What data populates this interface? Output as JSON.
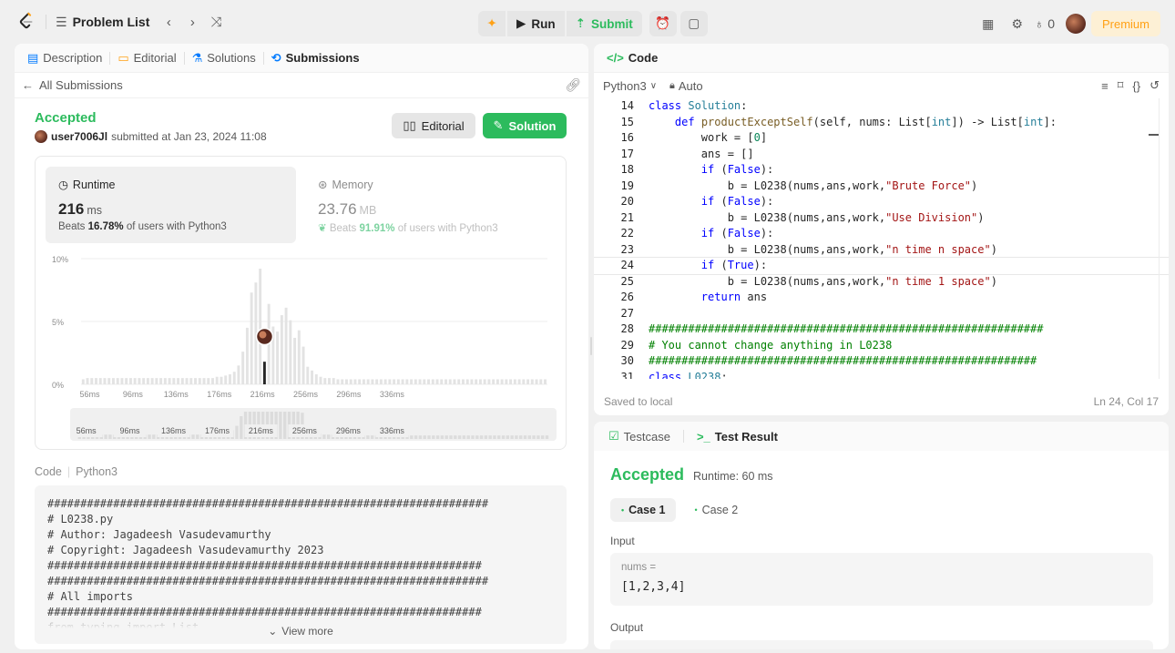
{
  "topbar": {
    "problem_list_label": "Problem List",
    "run_label": "Run",
    "submit_label": "Submit",
    "fire_count": "0",
    "premium_label": "Premium"
  },
  "left_tabs": {
    "description": "Description",
    "editorial": "Editorial",
    "solutions": "Solutions",
    "submissions": "Submissions"
  },
  "submission": {
    "back_label": "All Submissions",
    "status": "Accepted",
    "user": "user7006Jl",
    "submitted_text": "submitted at Jan 23, 2024 11:08",
    "editorial_button": "Editorial",
    "solution_button": "Solution",
    "runtime": {
      "label": "Runtime",
      "value": "216",
      "unit": "ms",
      "beats_prefix": "Beats",
      "beats_pct": "16.78%",
      "beats_suffix": "of users with Python3"
    },
    "memory": {
      "label": "Memory",
      "value": "23.76",
      "unit": "MB",
      "beats_prefix": "Beats",
      "beats_pct": "91.91%",
      "beats_suffix": "of users with Python3"
    },
    "code_label": "Code",
    "code_lang": "Python3",
    "code_lines": [
      "###################################################################",
      "# L0238.py",
      "# Author: Jagadeesh Vasudevamurthy",
      "# Copyright: Jagadeesh Vasudevamurthy 2023",
      "##################################################################",
      "###################################################################",
      "# All imports",
      "##################################################################",
      "from typing import List"
    ],
    "view_more": "View more"
  },
  "chart_data": {
    "type": "bar",
    "title": "",
    "xlabel": "",
    "ylabel": "",
    "ylim": [
      0,
      10
    ],
    "y_ticks": [
      "10%",
      "5%",
      "0%"
    ],
    "x_tick_labels": [
      "56ms",
      "96ms",
      "136ms",
      "176ms",
      "216ms",
      "256ms",
      "296ms",
      "336ms"
    ],
    "x_tick_values": [
      56,
      96,
      136,
      176,
      216,
      256,
      296,
      336
    ],
    "bin_width_ms": 4,
    "x_start_ms": 48,
    "values": [
      0.4,
      0.5,
      0.5,
      0.5,
      0.5,
      0.5,
      0.5,
      0.5,
      0.5,
      0.5,
      0.5,
      0.5,
      0.5,
      0.5,
      0.5,
      0.5,
      0.5,
      0.5,
      0.5,
      0.5,
      0.5,
      0.5,
      0.5,
      0.5,
      0.5,
      0.5,
      0.5,
      0.5,
      0.5,
      0.5,
      0.5,
      0.6,
      0.6,
      0.7,
      0.8,
      1.0,
      1.5,
      2.6,
      4.5,
      7.3,
      8.1,
      9.2,
      8.3,
      6.4,
      4.6,
      4.2,
      5.5,
      6.1,
      5.1,
      3.7,
      4.3,
      3.0,
      1.4,
      1.1,
      0.8,
      0.6,
      0.5,
      0.5,
      0.5,
      0.4,
      0.4,
      0.4,
      0.4,
      0.4,
      0.4,
      0.4,
      0.4,
      0.4,
      0.4,
      0.4,
      0.4,
      0.4,
      0.4,
      0.4,
      0.4,
      0.4,
      0.4,
      0.4,
      0.4,
      0.4,
      0.4,
      0.4,
      0.4,
      0.4,
      0.4,
      0.4,
      0.4,
      0.4,
      0.4,
      0.4,
      0.4,
      0.4,
      0.4,
      0.4,
      0.4,
      0.4,
      0.4,
      0.4,
      0.4,
      0.4,
      0.4,
      0.4,
      0.4,
      0.4,
      0.4,
      0.4,
      0.4,
      0.4
    ],
    "highlight_ms": 216,
    "grid": true
  },
  "code_panel": {
    "title": "Code",
    "language": "Python3",
    "mode": "Auto",
    "saved_text": "Saved to local",
    "cursor_pos": "Ln 24, Col 17",
    "current_line": 24,
    "lines": [
      {
        "n": "14",
        "html": "<span class='kw'>class</span> <span class='cls'>Solution</span>:"
      },
      {
        "n": "15",
        "html": "    <span class='kw'>def</span> <span class='fn'>productExceptSelf</span>(self, nums: List[<span class='cls'>int</span>]) -> List[<span class='cls'>int</span>]:"
      },
      {
        "n": "16",
        "html": "        work = [<span class='num'>0</span>]"
      },
      {
        "n": "17",
        "html": "        ans = []"
      },
      {
        "n": "18",
        "html": "        <span class='kw'>if</span> (<span class='kw'>False</span>):"
      },
      {
        "n": "19",
        "html": "            b = L0238(nums,ans,work,<span class='str'>\"Brute Force\"</span>)"
      },
      {
        "n": "20",
        "html": "        <span class='kw'>if</span> (<span class='kw'>False</span>):"
      },
      {
        "n": "21",
        "html": "            b = L0238(nums,ans,work,<span class='str'>\"Use Division\"</span>)"
      },
      {
        "n": "22",
        "html": "        <span class='kw'>if</span> (<span class='kw'>False</span>):"
      },
      {
        "n": "23",
        "html": "            b = L0238(nums,ans,work,<span class='str'>\"n time n space\"</span>)"
      },
      {
        "n": "24",
        "html": "        <span class='kw'>if</span> (<span class='kw'>True</span>):"
      },
      {
        "n": "25",
        "html": "            b = L0238(nums,ans,work,<span class='str'>\"n time 1 space\"</span>)"
      },
      {
        "n": "26",
        "html": "        <span class='kw'>return</span> ans"
      },
      {
        "n": "27",
        "html": ""
      },
      {
        "n": "28",
        "html": "<span class='cmt'>############################################################</span>"
      },
      {
        "n": "29",
        "html": "<span class='cmt'># You cannot change anything in L0238</span>"
      },
      {
        "n": "30",
        "html": "<span class='cmt'>###########################################################</span>"
      },
      {
        "n": "31",
        "html": "<span class='kw'>class</span> <span class='cls'>L0238</span>:"
      }
    ]
  },
  "test_panel": {
    "testcase_tab": "Testcase",
    "result_tab": "Test Result",
    "status": "Accepted",
    "runtime": "Runtime: 60 ms",
    "case1": "Case 1",
    "case2": "Case 2",
    "input_label": "Input",
    "input_name": "nums =",
    "input_value": "[1,2,3,4]",
    "output_label": "Output"
  },
  "colors": {
    "accent_green": "#2cbb5d",
    "brand_orange": "#ffa116",
    "premium_bg": "#fdf0d5",
    "link_blue": "#007aff"
  }
}
